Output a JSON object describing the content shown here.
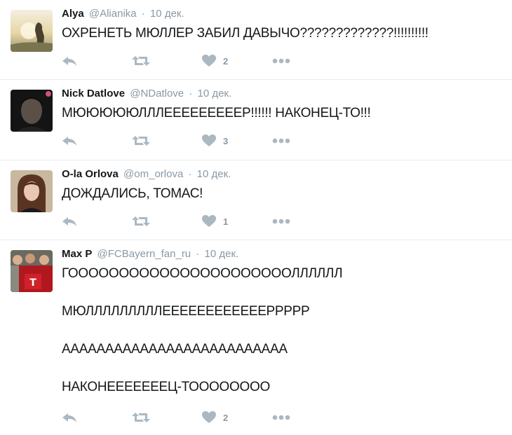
{
  "colors": {
    "meta": "#8899a6",
    "icon": "#aab8c2",
    "divider": "#e6ecf0"
  },
  "tweets": [
    {
      "name": "Alya",
      "handle": "@Alianika",
      "dot": "·",
      "time": "10 дек.",
      "lines": [
        "ОХРЕНЕТЬ МЮЛЛЕР ЗАБИЛ ДАВЫЧО?????????????!!!!!!!!!!"
      ],
      "likes": "2"
    },
    {
      "name": "Nick Datlove",
      "handle": "@NDatlove",
      "dot": "·",
      "time": "10 дек.",
      "lines": [
        "МЮЮЮЮЮЛЛЛЕЕЕЕЕЕЕЕЕР!!!!!! НАКОНЕЦ-ТО!!!"
      ],
      "likes": "3"
    },
    {
      "name": "O-la Orlova",
      "handle": "@om_orlova",
      "dot": "·",
      "time": "10 дек.",
      "lines": [
        "ДОЖДАЛИСЬ, ТОМАС!"
      ],
      "likes": "1"
    },
    {
      "name": "Max P",
      "handle": "@FCBayern_fan_ru",
      "dot": "·",
      "time": "10 дек.",
      "lines": [
        "ГООООООООООООООООООООООЛЛЛЛЛЛ",
        "МЮЛЛЛЛЛЛЛЛЛЕЕЕЕЕЕЕЕЕЕЕЕРРРРР",
        "АААААААААААААААААААААААААА",
        "НАКОНЕЕЕЕЕЕЕЦ-ТОООООООО"
      ],
      "likes": "2"
    }
  ]
}
